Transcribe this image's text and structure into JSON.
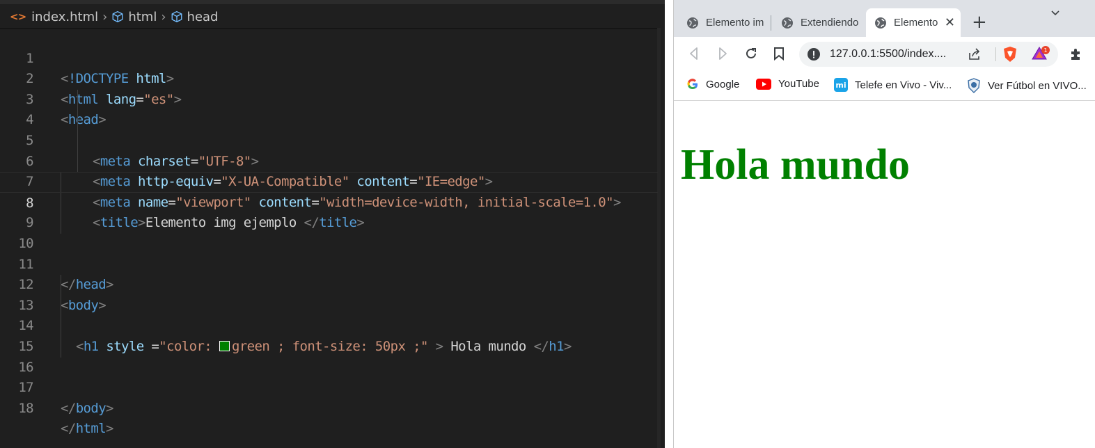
{
  "editor": {
    "breadcrumb": [
      "index.html",
      "html",
      "head"
    ],
    "lines": [
      {
        "num": "1"
      },
      {
        "num": "2"
      },
      {
        "num": "3"
      },
      {
        "num": "4"
      },
      {
        "num": "5"
      },
      {
        "num": "6"
      },
      {
        "num": "7"
      },
      {
        "num": "8"
      },
      {
        "num": "9"
      },
      {
        "num": "10"
      },
      {
        "num": "11"
      },
      {
        "num": "12"
      },
      {
        "num": "13"
      },
      {
        "num": "14"
      },
      {
        "num": "15"
      },
      {
        "num": "16"
      },
      {
        "num": "17"
      },
      {
        "num": "18"
      }
    ],
    "current_line": "8",
    "tokens": {
      "lt": "<",
      "gt": ">",
      "lt_slash": "</",
      "eq": "=",
      "sp": " ",
      "doctype": "!DOCTYPE",
      "html": "html",
      "lang": "lang",
      "es": "\"es\"",
      "head": "head",
      "meta": "meta",
      "charset": "charset",
      "utf8": "\"UTF-8\"",
      "http_equiv": "http-equiv",
      "xua": "\"X-UA-Compatible\"",
      "content": "content",
      "ie_edge": "\"IE=edge\"",
      "name": "name",
      "viewport": "\"viewport\"",
      "viewport_content": "\"width=device-width, initial-scale=1.0\"",
      "title": "title",
      "title_text": "Elemento img ejemplo ",
      "body": "body",
      "h1": "h1",
      "style": "style",
      "style_eq": " =",
      "style_pre": "\"color: ",
      "style_post": "green ; font-size: 50px ;\"",
      "h1_text": " Hola mundo "
    },
    "swatch_color": "#008000"
  },
  "browser": {
    "tabs": [
      {
        "label": "Elemento im",
        "active": false
      },
      {
        "label": "Extendiendo",
        "active": false
      },
      {
        "label": "Elemento",
        "active": true
      }
    ],
    "tab_close": "✕",
    "new_tab": "+",
    "url": "127.0.0.1:5500/index....",
    "bookmarks": [
      {
        "label": "Google",
        "icon": "google-icon"
      },
      {
        "label": "YouTube",
        "icon": "youtube-icon"
      },
      {
        "label": "Telefe en Vivo - Viv...",
        "icon": "mi-icon"
      },
      {
        "label": "Ver Fútbol en VIVO...",
        "icon": "shield-icon"
      }
    ],
    "page": {
      "heading": "Hola mundo",
      "heading_color": "#008000"
    }
  },
  "colors": {
    "editor_bg": "#1f1f1f",
    "tag": "#569cd6",
    "attribute": "#9cdcfe",
    "string": "#ce9178",
    "bracket": "#808080"
  }
}
